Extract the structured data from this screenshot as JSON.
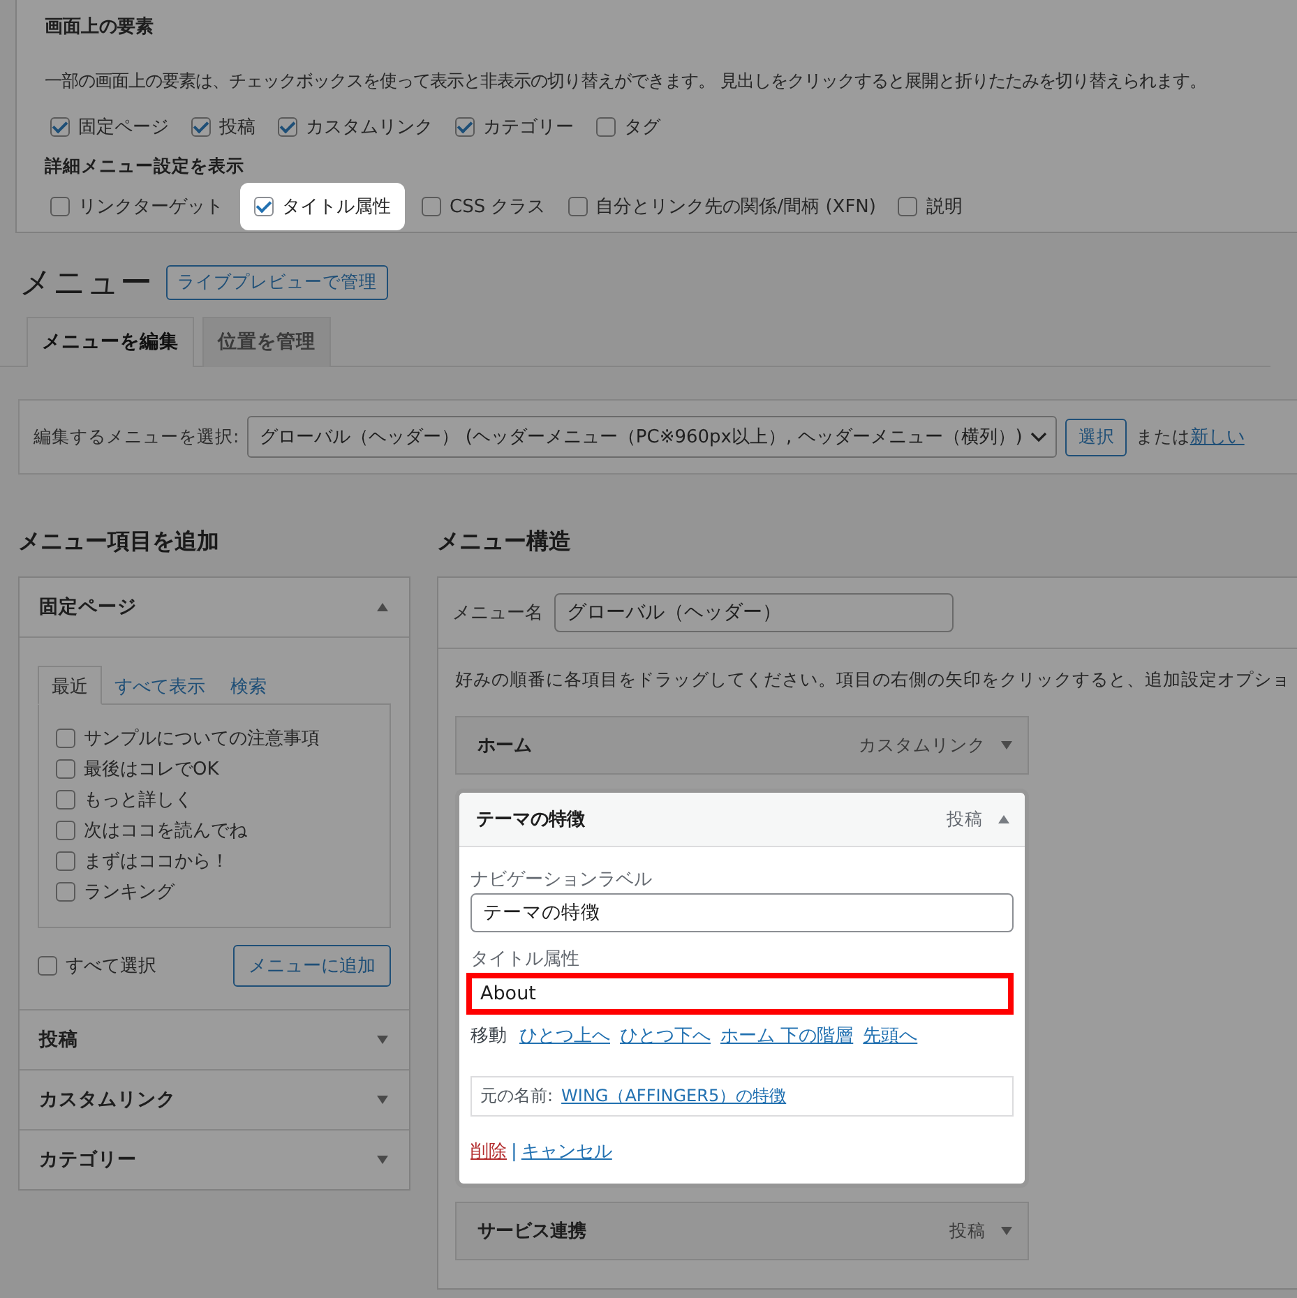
{
  "screen_options": {
    "title": "画面上の要素",
    "description": "一部の画面上の要素は、チェックボックスを使って表示と非表示の切り替えができます。 見出しをクリックすると展開と折りたたみを切り替えられます。",
    "boxes": [
      {
        "label": "固定ページ",
        "checked": true
      },
      {
        "label": "投稿",
        "checked": true
      },
      {
        "label": "カスタムリンク",
        "checked": true
      },
      {
        "label": "カテゴリー",
        "checked": true
      },
      {
        "label": "タグ",
        "checked": false
      }
    ],
    "advanced_title": "詳細メニュー設定を表示",
    "advanced_boxes": [
      {
        "label": "リンクターゲット",
        "checked": false,
        "highlighted": false
      },
      {
        "label": "タイトル属性",
        "checked": true,
        "highlighted": true
      },
      {
        "label": "CSS クラス",
        "checked": false,
        "highlighted": false
      },
      {
        "label": "自分とリンク先の関係/間柄 (XFN)",
        "checked": false,
        "highlighted": false
      },
      {
        "label": "説明",
        "checked": false,
        "highlighted": false
      }
    ]
  },
  "page_title": "メニュー",
  "live_preview_button": "ライブプレビューで管理",
  "tabs": [
    {
      "label": "メニューを編集",
      "selected": true
    },
    {
      "label": "位置を管理",
      "selected": false
    }
  ],
  "menu_select": {
    "label": "編集するメニューを選択:",
    "value": "グローバル（ヘッダー） (ヘッダーメニュー（PC※960px以上）, ヘッダーメニュー（横列）)",
    "button": "選択",
    "or_text": "または",
    "new_link": "新しい"
  },
  "add_items": {
    "title": "メニュー項目を追加",
    "sections": [
      {
        "title": "固定ページ",
        "expanded": true,
        "tabs": [
          {
            "label": "最近",
            "selected": true
          },
          {
            "label": "すべて表示",
            "selected": false
          },
          {
            "label": "検索",
            "selected": false
          }
        ],
        "items": [
          {
            "label": "サンプルについての注意事項",
            "checked": false
          },
          {
            "label": "最後はコレでOK",
            "checked": false
          },
          {
            "label": "もっと詳しく",
            "checked": false
          },
          {
            "label": "次はココを読んでね",
            "checked": false
          },
          {
            "label": "まずはココから！",
            "checked": false
          },
          {
            "label": "ランキング",
            "checked": false
          }
        ],
        "select_all": {
          "label": "すべて選択",
          "checked": false
        },
        "add_button": "メニューに追加"
      },
      {
        "title": "投稿",
        "expanded": false
      },
      {
        "title": "カスタムリンク",
        "expanded": false
      },
      {
        "title": "カテゴリー",
        "expanded": false
      }
    ]
  },
  "structure": {
    "title": "メニュー構造",
    "name_label": "メニュー名",
    "name_value": "グローバル（ヘッダー）",
    "instructions": "好みの順番に各項目をドラッグしてください。項目の右側の矢印をクリックすると、追加設定オプショ",
    "items": [
      {
        "title": "ホーム",
        "type": "カスタムリンク",
        "expanded": false
      },
      {
        "title": "テーマの特徴",
        "type": "投稿",
        "expanded": true,
        "nav_label": {
          "label": "ナビゲーションラベル",
          "value": "テーマの特徴"
        },
        "title_attr": {
          "label": "タイトル属性",
          "value": "About",
          "highlighted": true
        },
        "move_label": "移動",
        "move_links": [
          "ひとつ上へ",
          "ひとつ下へ",
          "ホーム 下の階層",
          "先頭へ"
        ],
        "original": {
          "label": "元の名前:",
          "link": "WING（AFFINGER5）の特徴"
        },
        "delete": "削除",
        "separator": "|",
        "cancel": "キャンセル"
      },
      {
        "title": "サービス連携",
        "type": "投稿",
        "expanded": false
      }
    ]
  }
}
